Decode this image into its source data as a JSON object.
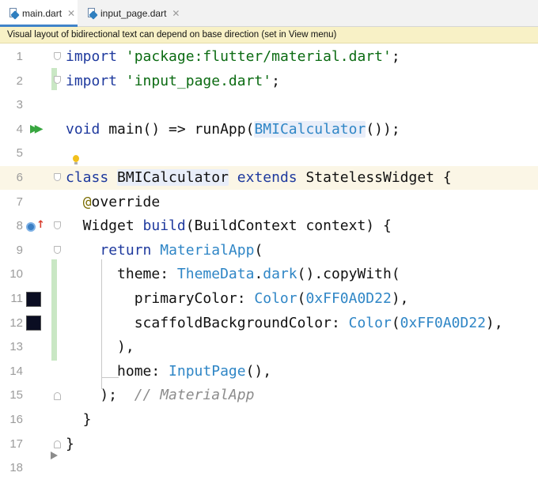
{
  "tabs": [
    {
      "label": "main.dart",
      "active": true,
      "icon": "dart-file-icon"
    },
    {
      "label": "input_page.dart",
      "active": false,
      "icon": "dart-file-icon"
    }
  ],
  "banner": "Visual layout of bidirectional text can depend on base direction (set in View menu)",
  "lines": [
    {
      "n": "1",
      "tokens": [
        {
          "t": "import",
          "c": "kw"
        },
        {
          "t": " "
        },
        {
          "t": "'package:flutter/material.dart'",
          "c": "str"
        },
        {
          "t": ";"
        }
      ]
    },
    {
      "n": "2",
      "tokens": [
        {
          "t": "import",
          "c": "kw"
        },
        {
          "t": " "
        },
        {
          "t": "'input_page.dart'",
          "c": "str"
        },
        {
          "t": ";"
        }
      ]
    },
    {
      "n": "3",
      "tokens": []
    },
    {
      "n": "4",
      "tokens": [
        {
          "t": "void",
          "c": "kw"
        },
        {
          "t": " main() => runApp("
        },
        {
          "t": "BMICalculator",
          "c": "cls hl-cls"
        },
        {
          "t": "());"
        }
      ]
    },
    {
      "n": "5",
      "tokens": []
    },
    {
      "n": "6",
      "tokens": [
        {
          "t": "class",
          "c": "kw"
        },
        {
          "t": " "
        },
        {
          "t": "BMICalculator",
          "c": "hl-cls"
        },
        {
          "t": " "
        },
        {
          "t": "extends",
          "c": "kw"
        },
        {
          "t": " StatelessWidget {"
        }
      ]
    },
    {
      "n": "7",
      "tokens": [
        {
          "t": "  "
        },
        {
          "t": "@",
          "c": "ann"
        },
        {
          "t": "override"
        }
      ]
    },
    {
      "n": "8",
      "tokens": [
        {
          "t": "  Widget "
        },
        {
          "t": "build",
          "c": "kw"
        },
        {
          "t": "(BuildContext context) {"
        }
      ]
    },
    {
      "n": "9",
      "tokens": [
        {
          "t": "    "
        },
        {
          "t": "return",
          "c": "kw"
        },
        {
          "t": " "
        },
        {
          "t": "MaterialApp",
          "c": "cls"
        },
        {
          "t": "("
        }
      ]
    },
    {
      "n": "10",
      "tokens": [
        {
          "t": "      theme: "
        },
        {
          "t": "ThemeData",
          "c": "cls"
        },
        {
          "t": "."
        },
        {
          "t": "dark",
          "c": "cls"
        },
        {
          "t": "().copyWith("
        }
      ]
    },
    {
      "n": "11",
      "tokens": [
        {
          "t": "        primaryColor: "
        },
        {
          "t": "Color",
          "c": "cls"
        },
        {
          "t": "("
        },
        {
          "t": "0xFF0A0D22",
          "c": "cls"
        },
        {
          "t": "),"
        }
      ]
    },
    {
      "n": "12",
      "tokens": [
        {
          "t": "        scaffoldBackgroundColor: "
        },
        {
          "t": "Color",
          "c": "cls"
        },
        {
          "t": "("
        },
        {
          "t": "0xFF0A0D22",
          "c": "cls"
        },
        {
          "t": "),"
        }
      ]
    },
    {
      "n": "13",
      "tokens": [
        {
          "t": "      ),"
        }
      ]
    },
    {
      "n": "14",
      "tokens": [
        {
          "t": "      home: "
        },
        {
          "t": "InputPage",
          "c": "cls"
        },
        {
          "t": "(),"
        }
      ]
    },
    {
      "n": "15",
      "tokens": [
        {
          "t": "    );  "
        },
        {
          "t": "// MaterialApp",
          "c": "cmt"
        }
      ]
    },
    {
      "n": "16",
      "tokens": [
        {
          "t": "  }"
        }
      ]
    },
    {
      "n": "17",
      "tokens": [
        {
          "t": "}"
        }
      ]
    },
    {
      "n": "18",
      "tokens": []
    }
  ],
  "colors": {
    "swatch": "#0A0D22",
    "keyword": "#1f3a9e",
    "string": "#0b6b12",
    "class": "#2f86c6"
  }
}
